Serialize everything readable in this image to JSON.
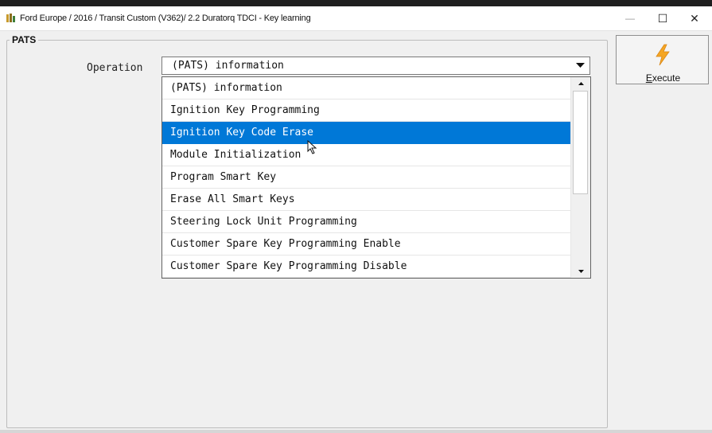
{
  "window": {
    "title": "Ford Europe / 2016 / Transit Custom (V362)/ 2.2 Duratorq TDCI - Key learning",
    "minimize_glyph": "—",
    "maximize_glyph": "☐",
    "close_glyph": "✕"
  },
  "group": {
    "label": "PATS"
  },
  "operation": {
    "label": "Operation",
    "selected_value": "(PATS) information",
    "options": [
      "(PATS) information",
      "Ignition Key Programming",
      "Ignition Key Code Erase",
      "Module Initialization",
      "Program Smart Key",
      "Erase All Smart Keys",
      "Steering Lock Unit Programming",
      "Customer Spare Key Programming Enable",
      "Customer Spare Key Programming Disable"
    ],
    "highlighted_option": "Ignition Key Code Erase"
  },
  "execute": {
    "mnemonic": "E",
    "label_rest": "xecute",
    "icon": "lightning-icon"
  },
  "colors": {
    "highlight": "#0078d7",
    "bolt": "#f5a623"
  }
}
